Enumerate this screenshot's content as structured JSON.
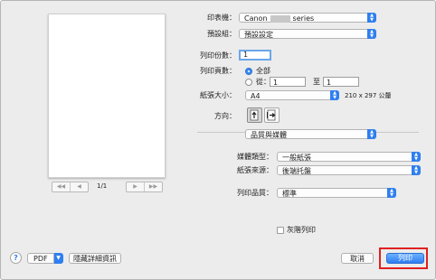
{
  "preview": {
    "page_indicator": "1/1",
    "first_label": "◀◀",
    "prev_label": "◀",
    "next_label": "▶",
    "last_label": "▶▶"
  },
  "printer": {
    "label": "印表機：",
    "value_prefix": "Canon",
    "value_suffix": "series"
  },
  "presets": {
    "label": "預設組：",
    "value": "預設設定"
  },
  "copies": {
    "label": "列印份數：",
    "value": "1"
  },
  "pages": {
    "label": "列印頁數：",
    "all_label": "全部",
    "from_label": "從：",
    "from_value": "1",
    "to_label": "至",
    "to_value": "1"
  },
  "paper_size": {
    "label": "紙張大小：",
    "value": "A4",
    "dimensions": "210 x 297 公釐"
  },
  "orientation": {
    "label": "方向："
  },
  "section": {
    "value": "品質與媒體"
  },
  "media_type": {
    "label": "媒體類型：",
    "value": "一般紙張"
  },
  "paper_source": {
    "label": "紙張來源：",
    "value": "後端托盤"
  },
  "print_quality": {
    "label": "列印品質：",
    "value": "標準"
  },
  "grayscale": {
    "label": "灰階列印"
  },
  "footer": {
    "help_label": "?",
    "pdf_label": "PDF",
    "hide_details_label": "隱藏詳細資訊",
    "cancel_label": "取消",
    "print_label": "列印"
  },
  "colors": {
    "accent": "#2f7ff0",
    "highlight": "#e02020"
  }
}
